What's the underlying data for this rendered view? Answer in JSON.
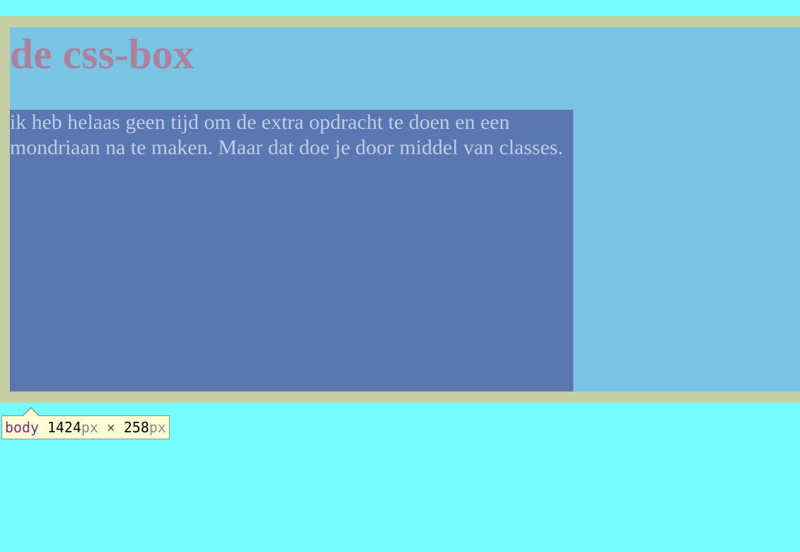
{
  "page": {
    "heading": "de css-box",
    "paragraph": "ik heb helaas geen tijd om de extra opdracht te doen en een mondriaan na te maken. Maar dat doe je door middel van classes."
  },
  "inspector_tooltip": {
    "tag": "body",
    "width": "1424",
    "height": "258",
    "unit": "px",
    "separator": " × "
  },
  "colors": {
    "page_background": "#75FDFD",
    "margin_highlight": "#C5CFA3",
    "content_highlight": "#79C3E3",
    "heading_text": "#AC819B",
    "box_background": "#5A77B1",
    "box_text": "#BCCDE8",
    "tooltip_background": "#FFFFD6"
  }
}
